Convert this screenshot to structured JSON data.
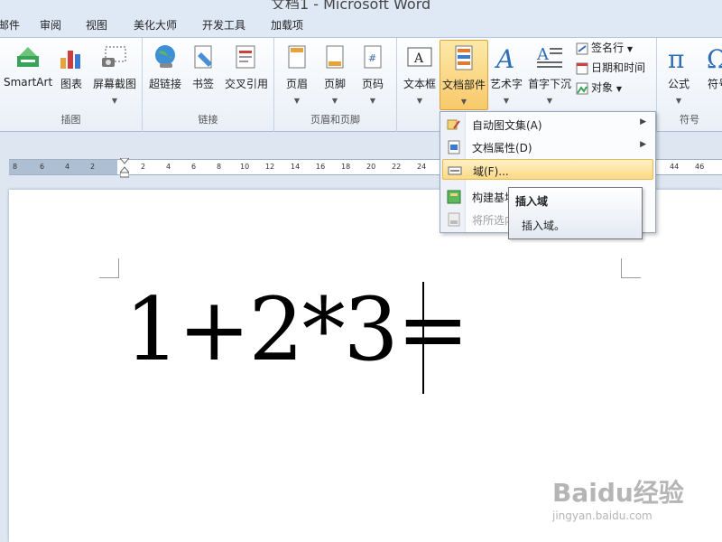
{
  "titlebar": {
    "title": "文档1 - Microsoft Word"
  },
  "tabs": [
    "邮件",
    "审阅",
    "视图",
    "美化大师",
    "开发工具",
    "加载项"
  ],
  "ribbon": {
    "groups": [
      {
        "label": "插图",
        "buttons": [
          "SmartArt",
          "图表",
          "屏幕截图"
        ]
      },
      {
        "label": "链接",
        "buttons": [
          "超链接",
          "书签",
          "交叉引用"
        ]
      },
      {
        "label": "页眉和页脚",
        "buttons": [
          "页眉",
          "页脚",
          "页码"
        ]
      },
      {
        "label": "",
        "buttons": [
          "文本框",
          "文档部件",
          "艺术字",
          "首字下沉"
        ]
      },
      {
        "label": "符号",
        "buttons": [
          "公式",
          "符号"
        ]
      }
    ],
    "text_small": [
      "签名行",
      "日期和时间",
      "对象"
    ]
  },
  "ruler": {
    "labels": [
      "8",
      "6",
      "4",
      "2",
      "2",
      "4",
      "6",
      "8",
      "10",
      "12",
      "14",
      "16",
      "18",
      "20",
      "22",
      "24",
      "44",
      "46"
    ]
  },
  "document": {
    "content": "1+2*3="
  },
  "menu": {
    "items": [
      {
        "label": "自动图文集(A)",
        "submenu": true,
        "enabled": true
      },
      {
        "label": "文档属性(D)",
        "submenu": true,
        "enabled": true
      },
      {
        "label": "域(F)...",
        "submenu": false,
        "enabled": true,
        "highlighted": true
      },
      {
        "label": "构建基块",
        "submenu": false,
        "enabled": true
      },
      {
        "label": "将所选内",
        "submenu": false,
        "enabled": false
      }
    ]
  },
  "tooltip": {
    "title": "插入域",
    "description": "插入域。"
  },
  "watermark": {
    "logo": "Baidu经验",
    "url": "jingyan.baidu.com"
  },
  "colors": {
    "highlight": "#fcd985",
    "ribbon": "#dfe9f5",
    "accent": "#1f5fa8"
  }
}
